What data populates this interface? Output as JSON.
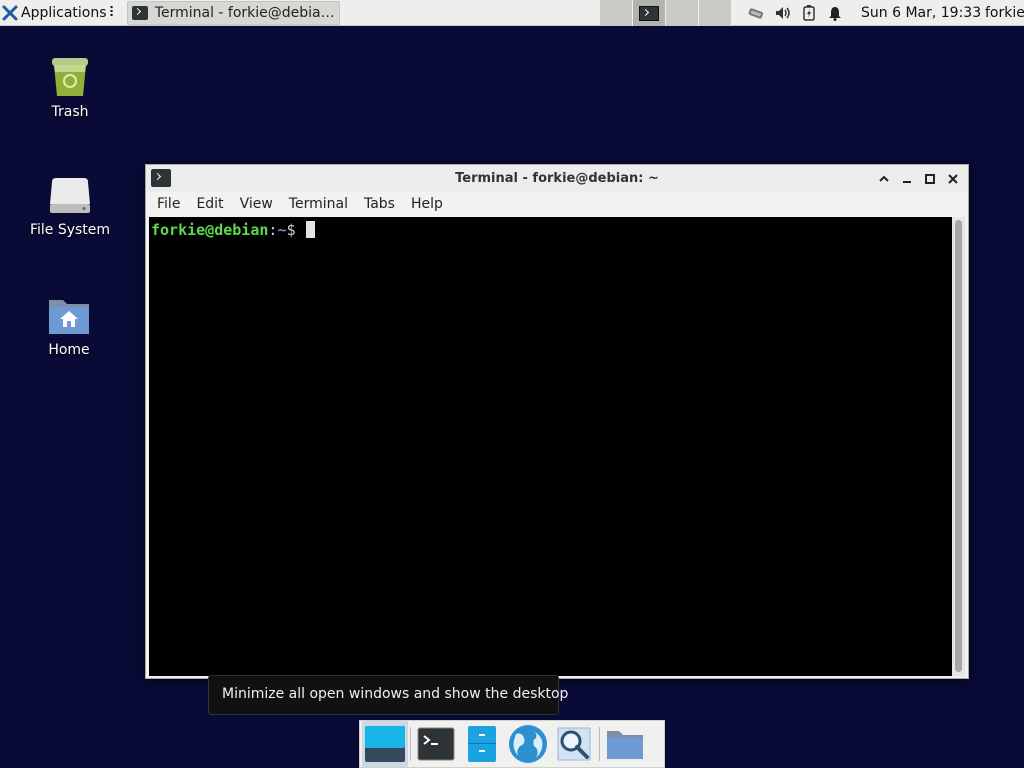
{
  "top_panel": {
    "applications_label": "Applications",
    "task_label": "Terminal - forkie@debia…",
    "clock": "Sun  6 Mar, 19:33",
    "user": "forkie"
  },
  "desktop_icons": {
    "trash": "Trash",
    "file_system": "File System",
    "home": "Home"
  },
  "terminal_window": {
    "title": "Terminal - forkie@debian: ~",
    "menu": [
      "File",
      "Edit",
      "View",
      "Terminal",
      "Tabs",
      "Help"
    ],
    "prompt": {
      "user_host": "forkie@debian",
      "colon": ":",
      "path": "~",
      "symbol": "$ "
    }
  },
  "tooltip": {
    "text": "Minimize all open windows and show the desktop"
  },
  "dock": {
    "items": [
      "show-desktop",
      "terminal",
      "file-manager",
      "web-browser",
      "app-finder",
      "home-folder"
    ]
  },
  "colors": {
    "desktop_bg": "#090a35",
    "prompt_user": "#5dd84f",
    "prompt_path": "#6c8fd4"
  }
}
